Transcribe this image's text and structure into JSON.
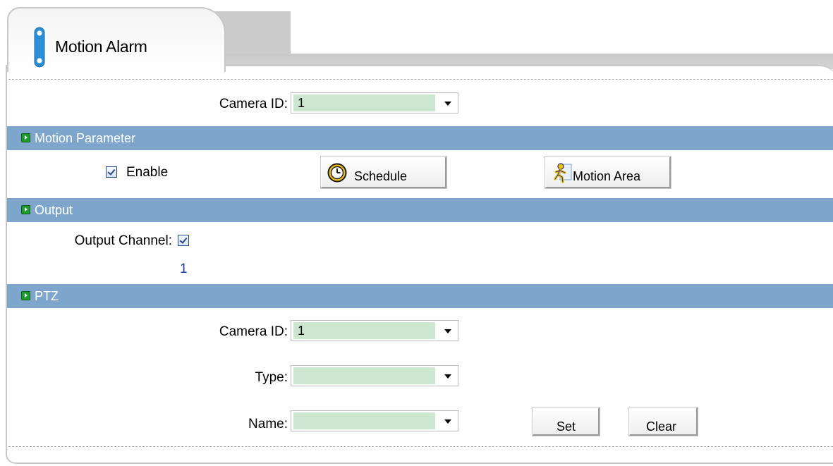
{
  "window": {
    "tab_title": "Motion Alarm"
  },
  "camera": {
    "label": "Camera ID:",
    "value": "1"
  },
  "sections": {
    "motion": "Motion Parameter",
    "output": "Output",
    "ptz": "PTZ"
  },
  "motion": {
    "enable_label": "Enable",
    "enable_checked": true,
    "schedule_label": "Schedule",
    "motion_area_label": "Motion Area"
  },
  "output": {
    "channel_label": "Output Channel:",
    "channel_checked": true,
    "channel_number": "1"
  },
  "ptz": {
    "camera_label": "Camera ID:",
    "camera_value": "1",
    "type_label": "Type:",
    "type_value": "",
    "name_label": "Name:",
    "name_value": "",
    "set_label": "Set",
    "clear_label": "Clear"
  },
  "colors": {
    "section_bar": "#7ea6cc",
    "select_fill": "#cde6cf",
    "section_icon": "#1e9c2a",
    "channel_number": "#1a3e9a"
  },
  "icons": {
    "tab": "info-pill-icon",
    "section": "green-arrow-icon",
    "schedule": "clock-icon",
    "motion_area": "running-person-icon"
  }
}
